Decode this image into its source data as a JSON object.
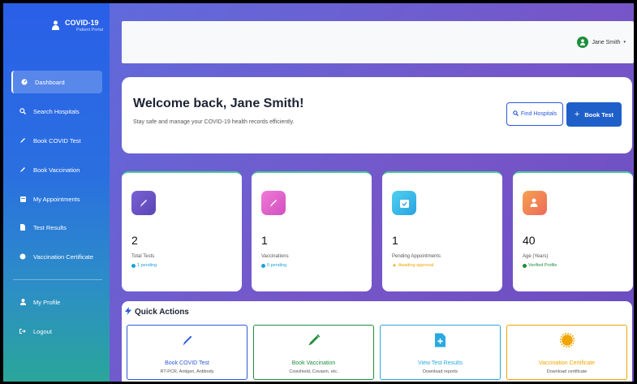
{
  "brand": {
    "title": "COVID-19",
    "subtitle": "Patient Portal"
  },
  "sidebar": {
    "items": [
      {
        "label": "Dashboard",
        "icon": "gauge-icon"
      },
      {
        "label": "Search Hospitals",
        "icon": "search-icon"
      },
      {
        "label": "Book COVID Test",
        "icon": "pen-icon"
      },
      {
        "label": "Book Vaccination",
        "icon": "syringe-icon"
      },
      {
        "label": "My Appointments",
        "icon": "calendar-icon"
      },
      {
        "label": "Test Results",
        "icon": "document-icon"
      },
      {
        "label": "Vaccination Certificate",
        "icon": "badge-icon"
      },
      {
        "label": "My Profile",
        "icon": "user-icon"
      },
      {
        "label": "Logout",
        "icon": "logout-icon"
      }
    ]
  },
  "header": {
    "user_name": "Jane Smith"
  },
  "welcome": {
    "title": "Welcome back, Jane Smith!",
    "subtitle": "Stay safe and manage your COVID-19 health records efficiently.",
    "find_label": "Find Hospitals",
    "book_label": "Book Test"
  },
  "stats": [
    {
      "value": "2",
      "label": "Total Tests",
      "sub": "1 pending",
      "sub_color": "#1aa3d6",
      "icon_bg": "#6e55c8"
    },
    {
      "value": "1",
      "label": "Vaccinations",
      "sub": "0 pending",
      "sub_color": "#1aa3d6",
      "icon_bg": "#e45fc9"
    },
    {
      "value": "1",
      "label": "Pending Appointments",
      "sub": "Awaiting approval",
      "sub_color": "#f0a500",
      "icon_bg": "#3ab8e8"
    },
    {
      "value": "40",
      "label": "Age (Years)",
      "sub": "Verified Profile",
      "sub_color": "#1e8e3e",
      "icon_bg": "#f0804d"
    }
  ],
  "quick_actions": {
    "title": "Quick Actions",
    "items": [
      {
        "label": "Book COVID Test",
        "sub": "RT-PCR, Antigen, Antibody",
        "color": "#2b5ad9"
      },
      {
        "label": "Book Vaccination",
        "sub": "Covishield, Covaxin, etc.",
        "color": "#1e8e3e"
      },
      {
        "label": "View Test Results",
        "sub": "Download reports",
        "color": "#29a9e0"
      },
      {
        "label": "Vaccination Certificate",
        "sub": "Download certificate",
        "color": "#f0a500"
      }
    ]
  }
}
